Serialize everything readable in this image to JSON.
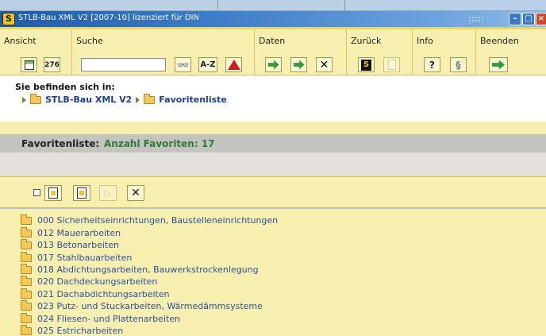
{
  "window": {
    "title": "STLB-Bau XML V2 [2007-10] lizenziert für DIN",
    "app_icon_letter": "S"
  },
  "toolbar": {
    "groups": [
      {
        "label": "Ansicht"
      },
      {
        "label": "Suche"
      },
      {
        "label": "Daten"
      },
      {
        "label": "Zurück"
      },
      {
        "label": "Info"
      },
      {
        "label": "Beenden"
      }
    ],
    "search": {
      "value": "",
      "placeholder": ""
    },
    "az_label": "A-Z",
    "num_label": "276",
    "s_label": "S",
    "q_label": "?"
  },
  "breadcrumb": {
    "label": "Sie befinden sich in:",
    "items": [
      "STLB-Bau XML V2",
      "Favoritenliste"
    ]
  },
  "favorites": {
    "title": "Favoritenliste:",
    "count_text": "Anzahl Favoriten: 17",
    "items": [
      "000 Sicherheitseinrichtungen, Baustelleneinrichtungen",
      "012 Mauerarbeiten",
      "013 Betonarbeiten",
      "017 Stahlbauarbeiten",
      "018 Abdichtungsarbeiten, Bauwerkstrockenlegung",
      "020 Dachdeckungsarbeiten",
      "021 Dachabdichtungsarbeiten",
      "023 Putz- und Stuckarbeiten, Wärmedämmsysteme",
      "024 Fliesen- und Plattenarbeiten",
      "025 Estricharbeiten"
    ]
  }
}
